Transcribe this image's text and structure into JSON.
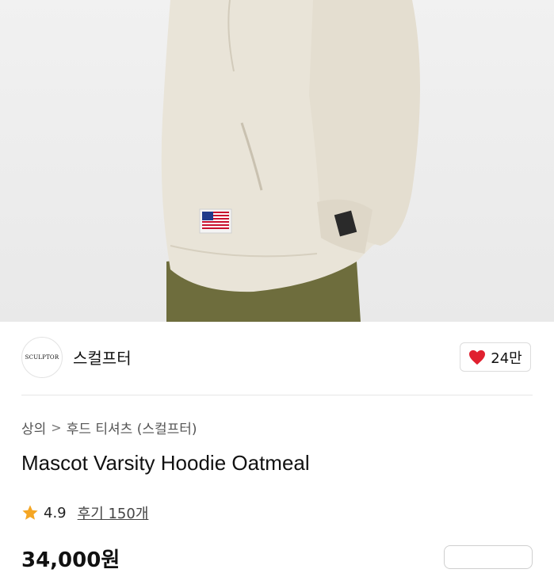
{
  "brand": {
    "logo_text": "SCULPTOR",
    "name": "스컬프터",
    "like_count": "24만"
  },
  "breadcrumb": {
    "category": "상의",
    "separator": ">",
    "subcategory": "후드 티셔츠 (스컬프터)"
  },
  "product": {
    "title": "Mascot Varsity Hoodie Oatmeal",
    "rating": "4.9",
    "reviews": "후기 150개",
    "price_partial": "34,000원"
  },
  "colors": {
    "heart": "#e0202f",
    "star": "#f5a623",
    "hoodie": "#e7e1d4",
    "pants": "#6b6a3c"
  },
  "icons": {
    "heart": "heart-icon",
    "star": "star-icon",
    "chevron": "chevron-right-icon"
  }
}
